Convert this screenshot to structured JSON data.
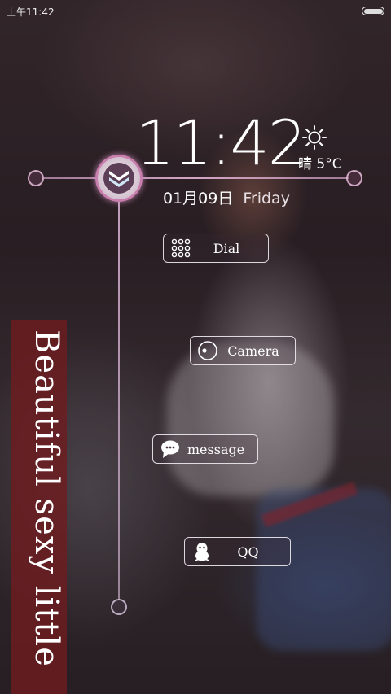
{
  "status_bar": {
    "time": "上午11:42",
    "battery_icon": "battery-full-icon"
  },
  "lockscreen": {
    "clock": "11:42",
    "weather_icon": "sun-icon",
    "weather": "晴 5°C",
    "date": "01月09日",
    "weekday": "Friday",
    "handle_icon": "double-chevron-down-icon"
  },
  "shortcuts": [
    {
      "label": "Dial",
      "icon": "dialpad-icon"
    },
    {
      "label": "Camera",
      "icon": "camera-icon"
    },
    {
      "label": "message",
      "icon": "chat-bubble-icon"
    },
    {
      "label": "QQ",
      "icon": "penguin-icon"
    }
  ],
  "banner": {
    "text": "Beautiful sexy little"
  },
  "colors": {
    "accent": "#d8a0c8",
    "banner": "#6e1c20"
  }
}
